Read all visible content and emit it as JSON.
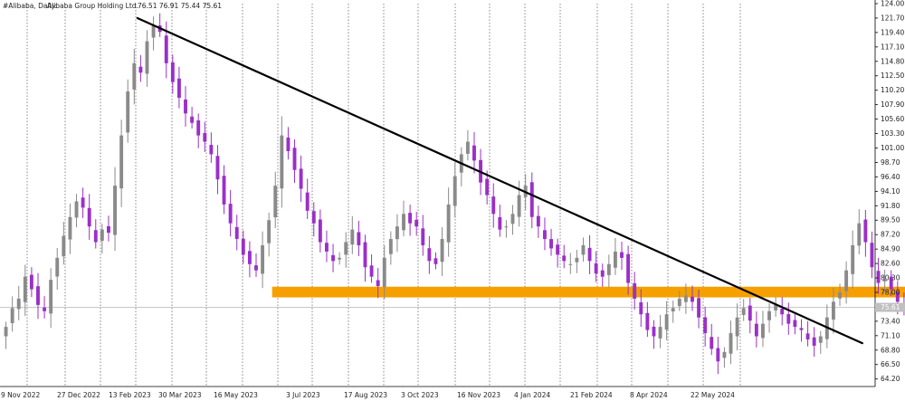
{
  "header": {
    "symbol": "#Alibaba, Daily:",
    "company": "Alibaba Group Holding Ltd.",
    "ohlc": "76.51 76.91 75.44 75.61"
  },
  "current_price_label": "75.61",
  "colors": {
    "background": "#ffffff",
    "bull": "#8a8a8a",
    "bear": "#9b2fc9",
    "trendline": "#000000",
    "zone": "#f5a000",
    "grid": "#555555",
    "price_line": "#c0c0c0",
    "price_tag": "#c0c0c0"
  },
  "chart_data": {
    "type": "candlestick",
    "title": "",
    "x_tick_labels": [
      "9 Nov 2022",
      "27 Dec 2022",
      "13 Feb 2023",
      "30 Mar 2023",
      "16 May 2023",
      "3 Jul 2023",
      "17 Aug 2023",
      "3 Oct 2023",
      "16 Nov 2023",
      "4 Jan 2024",
      "21 Feb 2024",
      "8 Apr 2024",
      "22 May 2024"
    ],
    "y_tick_labels": [
      "64.20",
      "66.50",
      "68.80",
      "71.10",
      "73.40",
      "78.00",
      "80.30",
      "82.60",
      "84.90",
      "87.20",
      "89.50",
      "91.80",
      "94.10",
      "96.40",
      "98.70",
      "101.00",
      "103.30",
      "105.60",
      "107.90",
      "110.20",
      "112.50",
      "114.80",
      "117.10",
      "119.40",
      "121.70",
      "124.00"
    ],
    "ylim": [
      63.0,
      124.0
    ],
    "xlim": [
      0,
      136
    ],
    "grid": "vertical dotted",
    "closes": [
      72.5,
      75.5,
      77.0,
      80.5,
      78.5,
      76.0,
      75.0,
      80.0,
      83.5,
      87.0,
      90.0,
      92.5,
      91.5,
      88.5,
      86.0,
      88.0,
      87.5,
      95.0,
      103.0,
      110.0,
      114.5,
      113.0,
      118.0,
      120.5,
      119.5,
      114.5,
      111.5,
      109.0,
      106.5,
      105.0,
      103.0,
      102.0,
      100.0,
      96.0,
      92.0,
      89.0,
      86.5,
      84.0,
      82.5,
      81.5,
      85.5,
      89.5,
      95.0,
      103.0,
      100.5,
      97.5,
      94.5,
      91.0,
      89.0,
      86.0,
      84.5,
      83.0,
      83.5,
      86.0,
      88.0,
      85.5,
      82.0,
      80.5,
      79.0,
      83.5,
      86.5,
      88.5,
      90.5,
      89.0,
      88.5,
      85.5,
      83.0,
      82.5,
      86.5,
      92.0,
      96.5,
      100.0,
      102.0,
      99.0,
      95.5,
      93.5,
      90.5,
      88.0,
      88.5,
      90.5,
      93.5,
      95.0,
      90.0,
      88.5,
      86.5,
      85.0,
      84.0,
      83.0,
      82.5,
      83.5,
      85.5,
      83.0,
      81.0,
      80.5,
      82.5,
      84.5,
      83.5,
      79.5,
      77.0,
      74.5,
      72.0,
      71.0,
      72.5,
      74.5,
      75.5,
      77.0,
      77.5,
      76.5,
      74.0,
      71.5,
      69.0,
      67.0,
      68.5,
      71.5,
      74.0,
      75.5,
      73.5,
      71.0,
      73.0,
      75.0,
      76.0,
      74.5,
      73.0,
      72.5,
      72.0,
      70.5,
      69.5,
      71.0,
      74.0,
      76.5,
      78.0,
      81.5,
      85.5,
      89.0,
      86.0,
      82.0,
      79.5,
      80.0,
      78.5,
      76.5,
      75.61
    ],
    "trendline": {
      "from": {
        "x": 21,
        "y": 121.7
      },
      "to": {
        "x": 134,
        "y": 69.9
      }
    },
    "zone": {
      "from_x": 42,
      "to_x": 143,
      "ymin": 77.2,
      "ymax": 78.9
    },
    "current_price": 75.61
  }
}
